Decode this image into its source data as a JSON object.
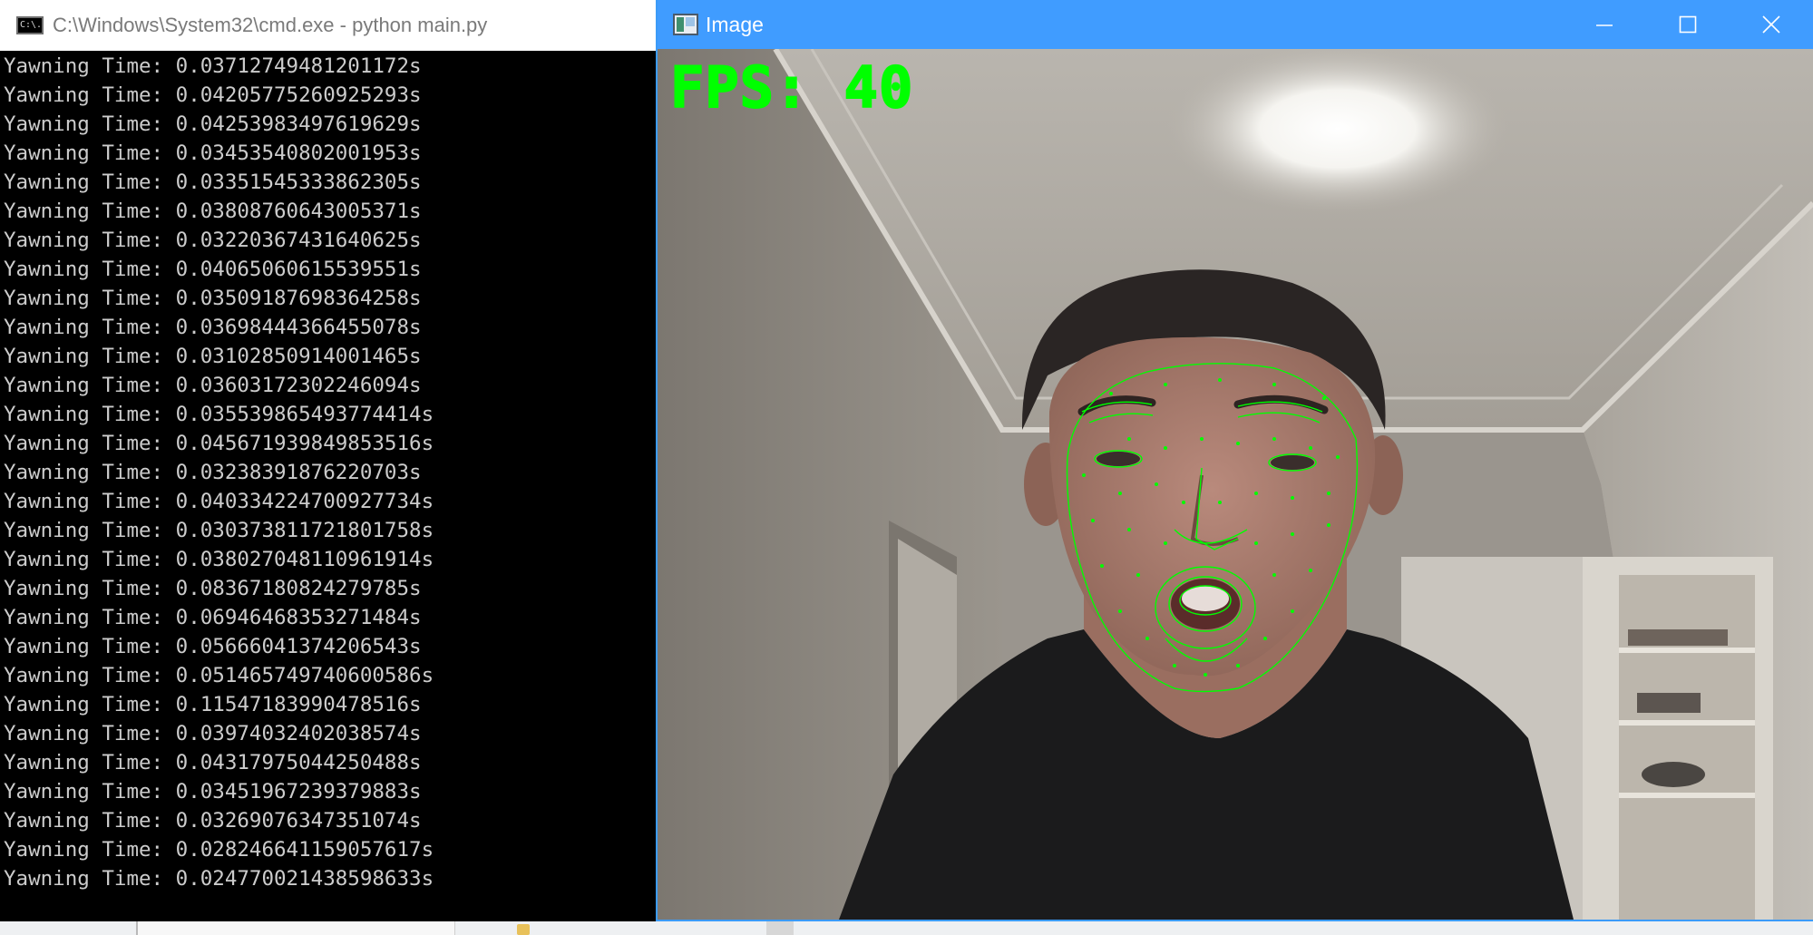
{
  "cmd_window": {
    "title": "C:\\Windows\\System32\\cmd.exe - python  main.py",
    "icon_text": "C:\\.",
    "lines": [
      "Yawning Time: 0.03712749481201172s",
      "Yawning Time: 0.04205775260925293s",
      "Yawning Time: 0.04253983497619629s",
      "Yawning Time: 0.03453540802001953s",
      "Yawning Time: 0.03351545333862305s",
      "Yawning Time: 0.03808760643005371s",
      "Yawning Time: 0.03220367431640625s",
      "Yawning Time: 0.04065060615539551s",
      "Yawning Time: 0.03509187698364258s",
      "Yawning Time: 0.03698444366455078s",
      "Yawning Time: 0.03102850914001465s",
      "Yawning Time: 0.03603172302246094s",
      "Yawning Time: 0.035539865493774414s",
      "Yawning Time: 0.045671939849853516s",
      "Yawning Time: 0.03238391876220703s",
      "Yawning Time: 0.040334224700927734s",
      "Yawning Time: 0.030373811721801758s",
      "Yawning Time: 0.038027048110961914s",
      "Yawning Time: 0.08367180824279785s",
      "Yawning Time: 0.06946468353271484s",
      "Yawning Time: 0.05666041374206543s",
      "Yawning Time: 0.051465749740600586s",
      "Yawning Time: 0.11547183990478516s",
      "Yawning Time: 0.03974032402038574s",
      "Yawning Time: 0.04317975044250488s",
      "Yawning Time: 0.03451967239379883s",
      "Yawning Time: 0.03269076347351074s",
      "Yawning Time: 0.028246641159057617s",
      "Yawning Time: 0.024770021438598633s"
    ]
  },
  "image_window": {
    "title": "Image",
    "fps_label": "FPS: 40",
    "overlay_color": "#00ff00",
    "titlebar_color": "#409cff",
    "buttons": {
      "minimize_icon": "minimize-icon",
      "maximize_icon": "maximize-icon",
      "close_icon": "close-icon"
    }
  }
}
